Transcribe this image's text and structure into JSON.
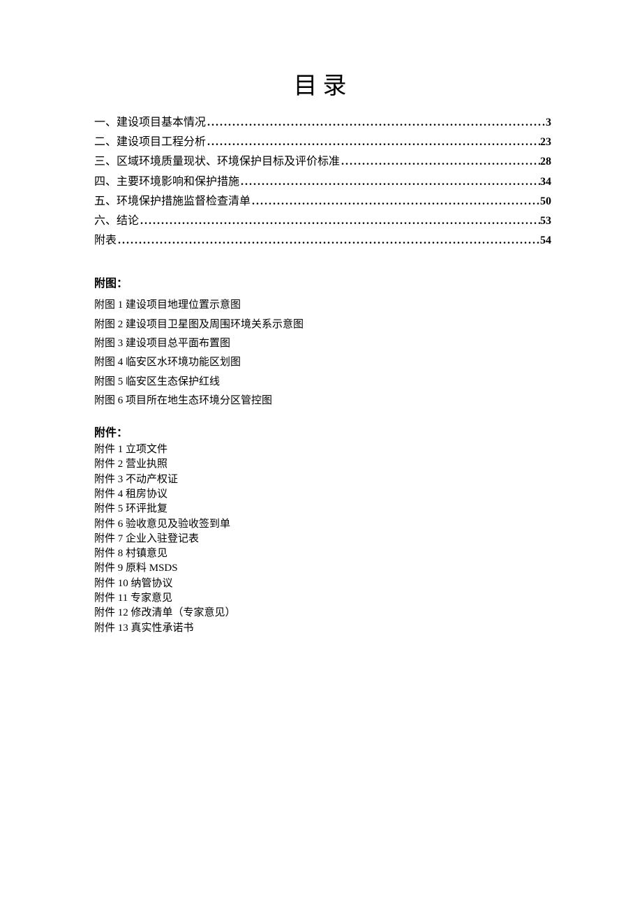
{
  "title": "目录",
  "toc": [
    {
      "label": "一、建设项目基本情况",
      "page": "3"
    },
    {
      "label": "二、建设项目工程分析",
      "page": "23"
    },
    {
      "label": "三、区域环境质量现状、环境保护目标及评价标准",
      "page": "28"
    },
    {
      "label": "四、主要环境影响和保护措施",
      "page": "34"
    },
    {
      "label": "五、环境保护措施监督检查清单",
      "page": "50"
    },
    {
      "label": "六、结论",
      "page": "53"
    },
    {
      "label": "附表",
      "page": "54"
    }
  ],
  "figures_heading": "附图：",
  "figures": [
    "附图 1 建设项目地理位置示意图",
    "附图 2 建设项目卫星图及周围环境关系示意图",
    "附图 3 建设项目总平面布置图",
    "附图 4 临安区水环境功能区划图",
    "附图 5 临安区生态保护红线",
    "附图 6 项目所在地生态环境分区管控图"
  ],
  "attachments_heading": "附件：",
  "attachments": [
    "附件 1 立项文件",
    "附件 2 营业执照",
    "附件 3 不动产权证",
    "附件 4 租房协议",
    "附件 5 环评批复",
    "附件 6 验收意见及验收签到单",
    "附件 7 企业入驻登记表",
    "附件 8 村镇意见",
    "附件 9 原料 MSDS",
    "附件 10 纳管协议",
    "附件 11 专家意见",
    "附件 12 修改清单（专家意见）",
    "附件 13 真实性承诺书"
  ]
}
